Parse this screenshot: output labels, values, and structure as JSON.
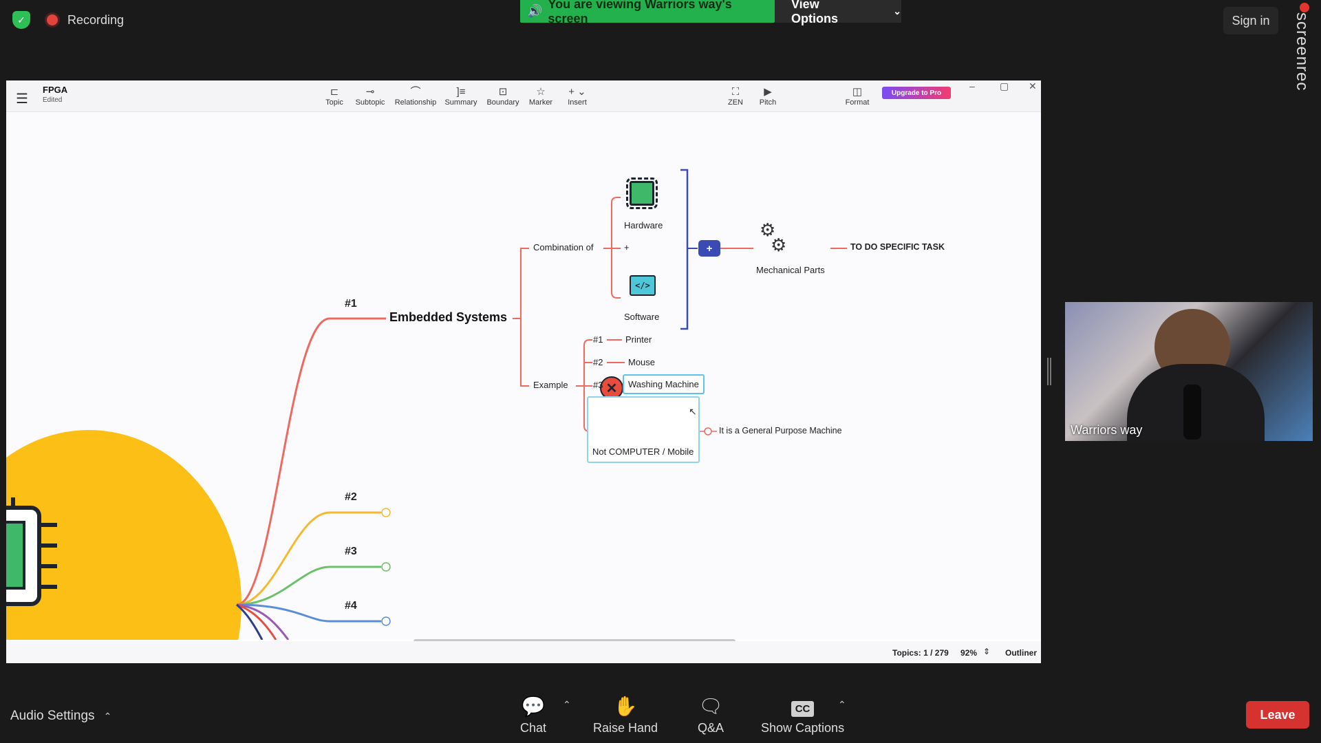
{
  "zoom_top": {
    "recording_label": "Recording",
    "viewing_banner": "You are viewing Warriors way's screen",
    "view_options": "View Options",
    "sign_in": "Sign in",
    "screenrec_watermark": "screenrec"
  },
  "app": {
    "doc_title": "FPGA",
    "doc_status": "Edited",
    "toolbar": [
      {
        "label": "Topic",
        "icon": "topic-icon"
      },
      {
        "label": "Subtopic",
        "icon": "subtopic-icon"
      },
      {
        "label": "Relationship",
        "icon": "relationship-icon"
      },
      {
        "label": "Summary",
        "icon": "summary-icon"
      },
      {
        "label": "Boundary",
        "icon": "boundary-icon"
      },
      {
        "label": "Marker",
        "icon": "star-icon"
      },
      {
        "label": "Insert",
        "icon": "plus-icon"
      }
    ],
    "zen_label": "ZEN",
    "pitch_label": "Pitch",
    "format_label": "Format",
    "upgrade_label": "Upgrade to Pro"
  },
  "mindmap": {
    "branch_1_number": "#1",
    "branch_2_number": "#2",
    "branch_3_number": "#3",
    "branch_4_number": "#4",
    "main_topic": "Embedded Systems",
    "combination_of": "Combination of",
    "plus_sign": "+",
    "hardware": "Hardware",
    "software": "Software",
    "summary_plus": "+",
    "mechanical_parts": "Mechanical Parts",
    "specific_task": "TO DO SPECIFIC TASK",
    "example": "Example",
    "ex1_num": "#1",
    "ex1": "Printer",
    "ex2_num": "#2",
    "ex2": "Mouse",
    "ex3_num": "#3",
    "ex3": "Washing Machine",
    "not_computer": "Not COMPUTER / Mobile",
    "general_purpose": "It is a General Purpose Machine"
  },
  "statusbar": {
    "topics": "Topics: 1 / 279",
    "zoom": "92%",
    "outliner": "Outliner"
  },
  "zoom_bottom": {
    "audio_settings": "Audio Settings",
    "chat": "Chat",
    "raise_hand": "Raise Hand",
    "qa": "Q&A",
    "captions_icon_text": "CC",
    "show_captions": "Show Captions",
    "leave": "Leave"
  },
  "video": {
    "participant_name": "Warriors way"
  },
  "colors": {
    "branch1": "#ef6a5e",
    "branch2": "#f5b82e",
    "branch3": "#6cc06a",
    "branch4": "#5a8ed8",
    "summary_bracket": "#3b4bb5",
    "central_blob": "#fbbf16",
    "zoom_green": "#22b14c",
    "leave_red": "#d6322f"
  }
}
